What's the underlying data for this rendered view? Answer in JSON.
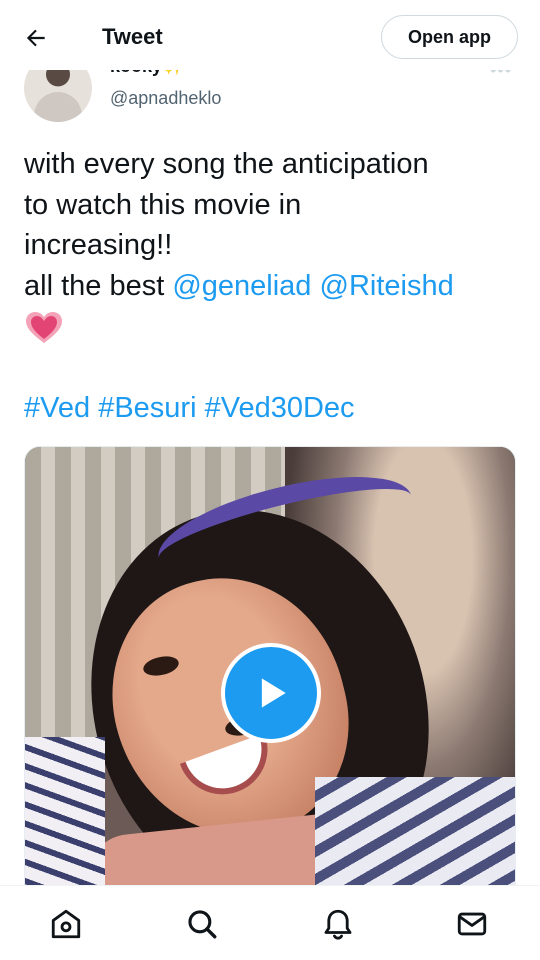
{
  "header": {
    "title": "Tweet",
    "open_app_label": "Open app"
  },
  "author": {
    "display_name": "kooky",
    "display_name_emoji": "✨",
    "handle": "@apnadheklo",
    "more": "•••"
  },
  "tweet": {
    "line1": "with every song the anticipation",
    "line2": "to watch this movie in",
    "line3": "increasing!!",
    "line4_prefix": "all the best ",
    "mention1": "@geneliad",
    "mention2": "@Riteishd",
    "hashtags": [
      "#Ved",
      "#Besuri",
      "#Ved30Dec"
    ]
  },
  "media": {
    "type": "video",
    "play_icon": "play-icon"
  },
  "nav": {
    "items": [
      "home-icon",
      "search-icon",
      "notifications-icon",
      "messages-icon"
    ]
  },
  "colors": {
    "accent": "#1d9bf0",
    "text": "#0f1419",
    "secondary_text": "#536471"
  }
}
